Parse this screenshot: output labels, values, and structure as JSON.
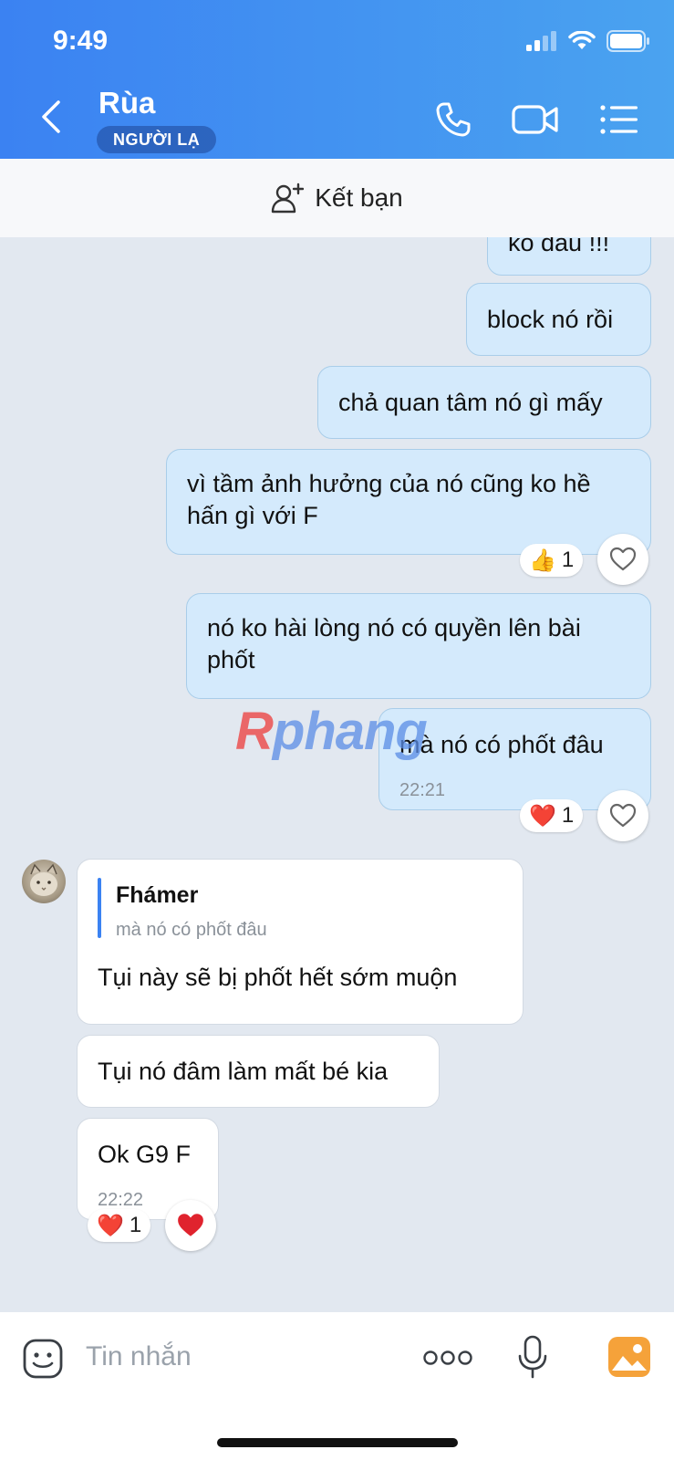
{
  "status_bar": {
    "time": "9:49"
  },
  "header": {
    "contact_name": "Rùa",
    "stranger_badge": "NGƯỜI LẠ"
  },
  "friend_bar": {
    "label": "Kết bạn"
  },
  "messages": [
    {
      "id": "m0",
      "text": "ko đâu !!!",
      "side": "out"
    },
    {
      "id": "m1",
      "text": "block nó rồi",
      "side": "out"
    },
    {
      "id": "m2",
      "text": "chả quan tâm nó gì mấy",
      "side": "out"
    },
    {
      "id": "m3",
      "line1": "vì tầm ảnh hưởng của nó cũng ko hề",
      "line2": "hấn gì với F",
      "side": "out",
      "reaction": {
        "emoji": "👍",
        "count": "1"
      }
    },
    {
      "id": "m4",
      "line1": "nó ko hài lòng nó có quyền lên bài",
      "line2": "phốt",
      "side": "out"
    },
    {
      "id": "m5",
      "text": "mà nó có phốt đâu",
      "time": "22:21",
      "side": "out",
      "reaction": {
        "emoji": "❤️",
        "count": "1"
      }
    },
    {
      "id": "m6",
      "reply_to_name": "Fhámer",
      "reply_to_text": "mà nó có phốt đâu",
      "text": "Tụi này sẽ bị phốt hết sớm muộn",
      "side": "in"
    },
    {
      "id": "m7",
      "text": "Tụi nó đâm làm mất bé kia",
      "side": "in"
    },
    {
      "id": "m8",
      "text": "Ok G9 F",
      "time": "22:22",
      "side": "in",
      "reaction": {
        "emoji": "❤️",
        "count": "1"
      }
    }
  ],
  "watermark": {
    "r": "R",
    "rest": "phang"
  },
  "input": {
    "placeholder": "Tin nhắn"
  },
  "icons": {
    "back": "chevron-left-icon",
    "call": "phone-icon",
    "video": "video-camera-icon",
    "menu": "list-menu-icon",
    "add_friend": "add-user-icon",
    "sticker": "sticker-face-icon",
    "more": "more-dots-icon",
    "mic": "microphone-icon",
    "image": "image-gallery-icon"
  },
  "colors": {
    "header_start": "#3b82f2",
    "header_end": "#4aa3f0",
    "outgoing_bubble": "#d4eafc",
    "incoming_bubble": "#ffffff",
    "chat_background": "#e2e8f0",
    "image_icon": "#f5a23a"
  }
}
